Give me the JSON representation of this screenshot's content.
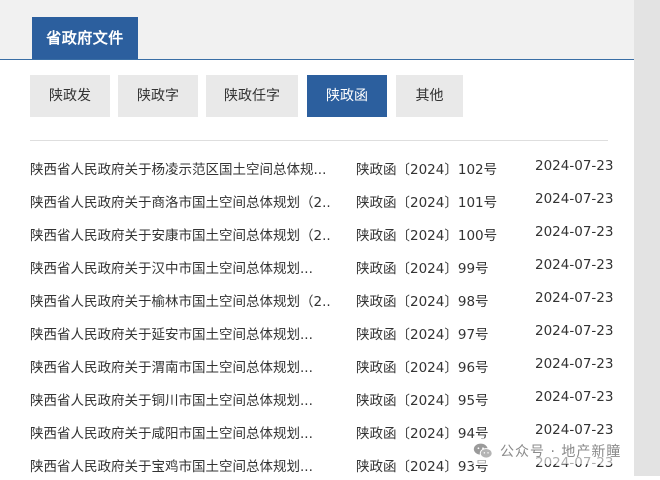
{
  "section": {
    "title": "省政府文件"
  },
  "category_tabs": [
    {
      "label": "陕政发"
    },
    {
      "label": "陕政字"
    },
    {
      "label": "陕政任字"
    },
    {
      "label": "陕政函"
    },
    {
      "label": "其他"
    }
  ],
  "active_tab_index": 3,
  "documents": [
    {
      "title": "陕西省人民政府关于杨凌示范区国土空间总体规...",
      "number": "陕政函〔2024〕102号",
      "date": "2024-07-23"
    },
    {
      "title": "陕西省人民政府关于商洛市国土空间总体规划（2...",
      "number": "陕政函〔2024〕101号",
      "date": "2024-07-23"
    },
    {
      "title": "陕西省人民政府关于安康市国土空间总体规划（2...",
      "number": "陕政函〔2024〕100号",
      "date": "2024-07-23"
    },
    {
      "title": "陕西省人民政府关于汉中市国土空间总体规划...",
      "number": "陕政函〔2024〕99号",
      "date": "2024-07-23"
    },
    {
      "title": "陕西省人民政府关于榆林市国土空间总体规划（2...",
      "number": "陕政函〔2024〕98号",
      "date": "2024-07-23"
    },
    {
      "title": "陕西省人民政府关于延安市国土空间总体规划...",
      "number": "陕政函〔2024〕97号",
      "date": "2024-07-23"
    },
    {
      "title": "陕西省人民政府关于渭南市国土空间总体规划...",
      "number": "陕政函〔2024〕96号",
      "date": "2024-07-23"
    },
    {
      "title": "陕西省人民政府关于铜川市国土空间总体规划...",
      "number": "陕政函〔2024〕95号",
      "date": "2024-07-23"
    },
    {
      "title": "陕西省人民政府关于咸阳市国土空间总体规划...",
      "number": "陕政函〔2024〕94号",
      "date": "2024-07-23"
    },
    {
      "title": "陕西省人民政府关于宝鸡市国土空间总体规划...",
      "number": "陕政函〔2024〕93号",
      "date": "2024-07-23"
    }
  ],
  "watermark": {
    "text": "公众号 · 地产新瞳",
    "icon": "wechat-icon"
  },
  "colors": {
    "accent": "#2c5f9e",
    "tab_bg": "#e9e9e9",
    "header_bg": "#f1f1f1",
    "text": "#333333"
  }
}
